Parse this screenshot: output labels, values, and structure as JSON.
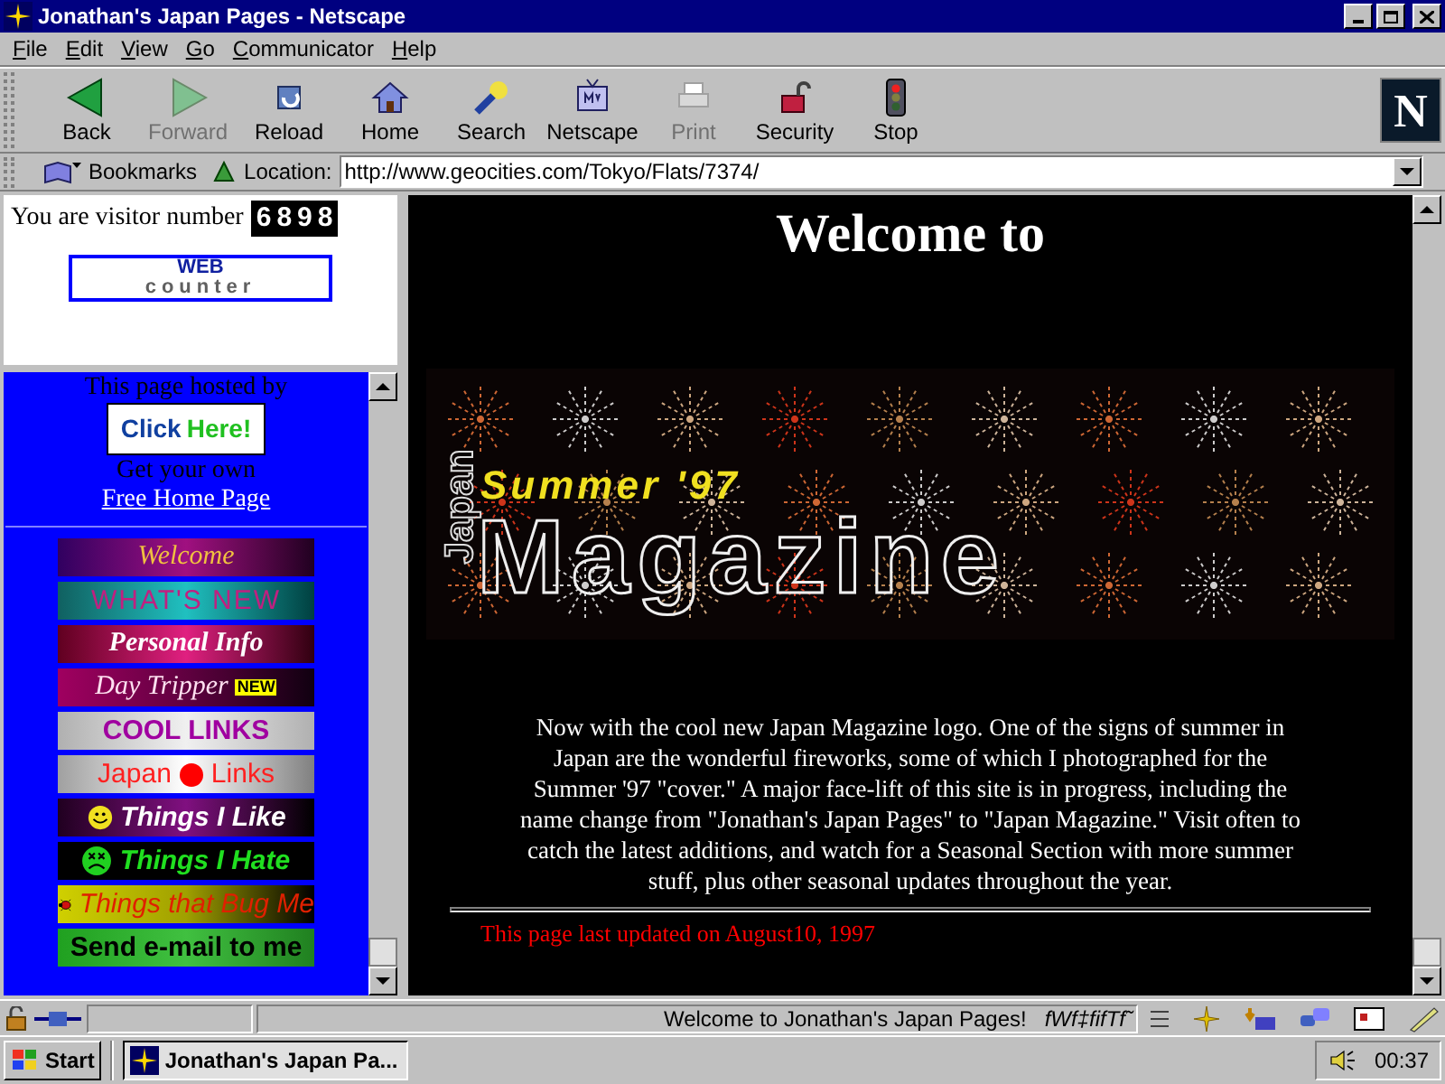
{
  "window": {
    "title": "Jonathan's Japan Pages - Netscape"
  },
  "menu": [
    "File",
    "Edit",
    "View",
    "Go",
    "Communicator",
    "Help"
  ],
  "toolbar": [
    {
      "label": "Back",
      "disabled": false
    },
    {
      "label": "Forward",
      "disabled": true
    },
    {
      "label": "Reload",
      "disabled": false
    },
    {
      "label": "Home",
      "disabled": false
    },
    {
      "label": "Search",
      "disabled": false
    },
    {
      "label": "Netscape",
      "disabled": false
    },
    {
      "label": "Print",
      "disabled": true
    },
    {
      "label": "Security",
      "disabled": false
    },
    {
      "label": "Stop",
      "disabled": false
    }
  ],
  "logo_letter": "N",
  "location_bar": {
    "bookmarks": "Bookmarks",
    "label": "Location:",
    "url": "http://www.geocities.com/Tokyo/Flats/7374/"
  },
  "counter_frame": {
    "text": "You are visitor number",
    "digits": [
      "6",
      "8",
      "9",
      "8"
    ],
    "logo_top": "WEB",
    "logo_bottom": "counter"
  },
  "nav_frame": {
    "hosted": "This page hosted by",
    "click_1": "Click",
    "click_2": "Here!",
    "own": "Get your own",
    "link": "Free Home Page",
    "buttons": [
      {
        "label": "Welcome",
        "kind": "plain"
      },
      {
        "label": "WHAT'S NEW",
        "kind": "plain"
      },
      {
        "label": "Personal Info",
        "kind": "plain"
      },
      {
        "label": "Day Tripper",
        "kind": "badge",
        "badge": "NEW"
      },
      {
        "label": "COOL LINKS",
        "kind": "plain"
      },
      {
        "label": "Japan",
        "label_2": "Links",
        "kind": "dot"
      },
      {
        "label": "Things I Like",
        "kind": "smiley"
      },
      {
        "label": "Things I Hate",
        "kind": "frown"
      },
      {
        "label": "Things that Bug Me",
        "kind": "bug"
      },
      {
        "label": "Send e-mail to me",
        "kind": "plain"
      }
    ]
  },
  "main": {
    "heading": "Welcome to",
    "banner": {
      "side": "Japan",
      "subtitle": "Summer '97",
      "title": "Magazine"
    },
    "paragraph": "Now with the cool new Japan Magazine logo. One of the signs of summer in Japan are the wonderful fireworks, some of which I photographed for the Summer '97 \"cover.\" A major face-lift of this site is in progress, including the name change from \"Jonathan's Japan Pages\" to \"Japan Magazine.\" Visit often to catch the latest additions, and watch for a Seasonal Section with more summer stuff, plus other seasonal updates throughout the year.",
    "updated": "This page last updated on August10, 1997"
  },
  "status_bar": {
    "message": "Welcome to Jonathan's Japan Pages!",
    "garbled": "fWf‡fifTf˜"
  },
  "taskbar": {
    "start": "Start",
    "task": "Jonathan's Japan Pa...",
    "clock": "00:37"
  }
}
